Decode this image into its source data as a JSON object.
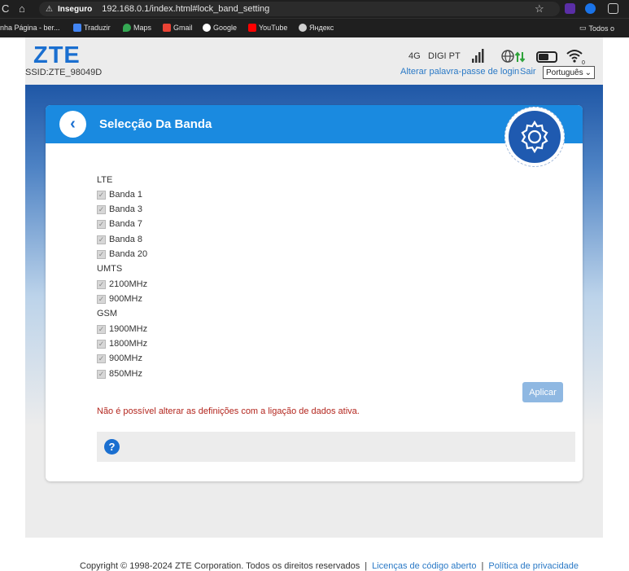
{
  "browser": {
    "nav_left": "C",
    "home_icon": "home-icon",
    "insecure_label": "Inseguro",
    "url": "192.168.0.1/index.html#lock_band_setting",
    "bookmarks": [
      {
        "label": "inha Página - ber...",
        "color": "#3a3a3a"
      },
      {
        "label": "Traduzir",
        "color": "#4285f4"
      },
      {
        "label": "Maps",
        "color": "#34a853"
      },
      {
        "label": "Gmail",
        "color": "#ea4335"
      },
      {
        "label": "Google",
        "color": "#ffffff"
      },
      {
        "label": "YouTube",
        "color": "#ff0000"
      },
      {
        "label": "Яндекс",
        "color": "#cfcfcf"
      }
    ],
    "all_bookmarks": "Todos o"
  },
  "header": {
    "logo": "ZTE",
    "ssid": "SSID:ZTE_98049D",
    "network_type": "4G",
    "operator": "DIGI PT",
    "change_password": "Alterar palavra-passe de login",
    "logout": "Sair",
    "language": "Português",
    "colors": {
      "brand": "#1a6fd0",
      "link": "#2a79c6"
    }
  },
  "card": {
    "title": "Selecção Da Banda",
    "sections": [
      {
        "label": "LTE",
        "options": [
          "Banda 1",
          "Banda 3",
          "Banda 7",
          "Banda 8",
          "Banda 20"
        ]
      },
      {
        "label": "UMTS",
        "options": [
          "2100MHz",
          "900MHz"
        ]
      },
      {
        "label": "GSM",
        "options": [
          "1900MHz",
          "1800MHz",
          "900MHz",
          "850MHz"
        ]
      }
    ],
    "apply_label": "Aplicar",
    "warning": "Não é possível alterar as definições com a ligação de dados ativa.",
    "help_icon": "?"
  },
  "footer": {
    "copyright": "Copyright © 1998-2024 ZTE Corporation. Todos os direitos reservados",
    "open_source": "Licenças de código aberto",
    "privacy": "Política de privacidade",
    "separator": "|"
  }
}
